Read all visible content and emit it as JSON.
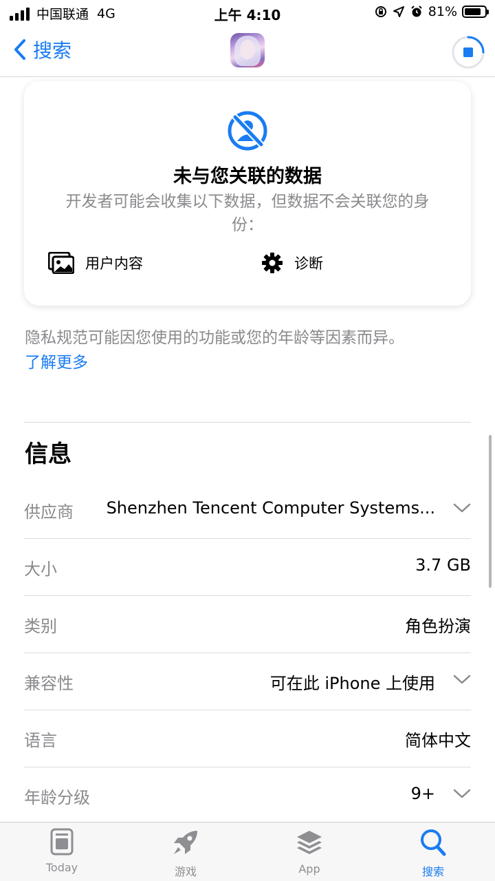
{
  "status_bar": {
    "carrier": "中国联通",
    "network": "4G",
    "time": "上午 4:10",
    "battery": "81%",
    "battery_level": 0.81
  },
  "nav": {
    "back_label": "搜索",
    "download_progress": 0.25
  },
  "privacy_card": {
    "title": "未与您关联的数据",
    "description": "开发者可能会收集以下数据，但数据不会关联您的身份：",
    "items": [
      {
        "label": "用户内容",
        "icon": "photo-icon"
      },
      {
        "label": "诊断",
        "icon": "gear-icon"
      }
    ]
  },
  "privacy_note": "隐私规范可能因您使用的功能或您的年龄等因素而异。",
  "learn_more": "了解更多",
  "info": {
    "title": "信息",
    "rows": [
      {
        "label": "供应商",
        "value": "Shenzhen Tencent Computer Systems...",
        "expandable": true
      },
      {
        "label": "大小",
        "value": "3.7 GB",
        "expandable": false
      },
      {
        "label": "类别",
        "value": "角色扮演",
        "expandable": false
      },
      {
        "label": "兼容性",
        "value": "可在此 iPhone 上使用",
        "expandable": true
      },
      {
        "label": "语言",
        "value": "简体中文",
        "expandable": false
      },
      {
        "label": "年龄分级",
        "value": "9+",
        "expandable": true
      }
    ]
  },
  "tabs": [
    {
      "label": "Today",
      "icon": "today-icon",
      "active": false
    },
    {
      "label": "游戏",
      "icon": "rocket-icon",
      "active": false
    },
    {
      "label": "App",
      "icon": "layers-icon",
      "active": false
    },
    {
      "label": "搜索",
      "icon": "search-icon",
      "active": true
    }
  ],
  "colors": {
    "accent": "#1a7cf2",
    "secondary_text": "#8a8a8e"
  }
}
